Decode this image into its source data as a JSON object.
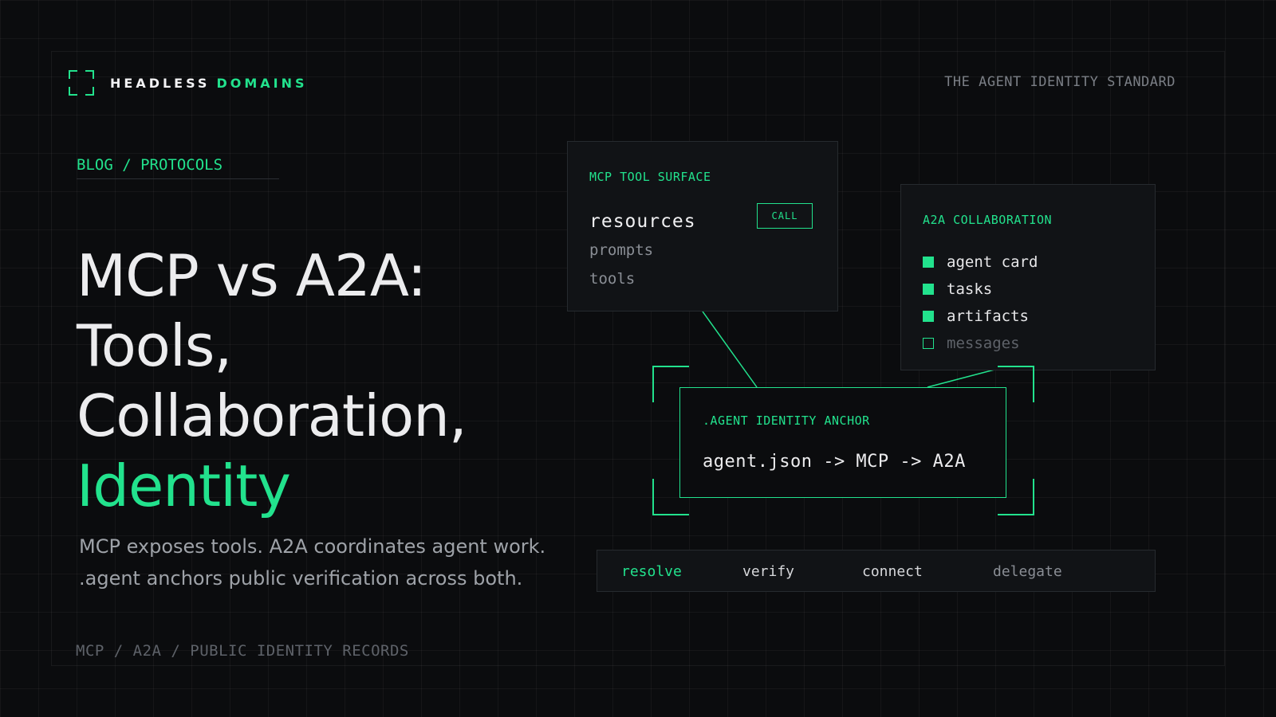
{
  "brand": {
    "name_white": "HEADLESS",
    "name_green": "DOMAINS",
    "icon": "bracket-frame-icon"
  },
  "header": {
    "tagline": "THE AGENT IDENTITY STANDARD"
  },
  "breadcrumb": "BLOG / PROTOCOLS",
  "headline": {
    "line1": "MCP vs A2A:",
    "line2": "Tools,",
    "line3": "Collaboration,",
    "line4": "Identity"
  },
  "subtitle": {
    "line1": "MCP exposes tools. A2A coordinates agent work.",
    "line2": ".agent anchors public verification across both."
  },
  "footer": {
    "crumb": "MCP / A2A / PUBLIC IDENTITY RECORDS"
  },
  "mcp_panel": {
    "title": "MCP TOOL SURFACE",
    "button": "CALL",
    "items": [
      "resources",
      "prompts",
      "tools"
    ]
  },
  "a2a_panel": {
    "title": "A2A COLLABORATION",
    "items": [
      {
        "label": "agent card",
        "checked": true
      },
      {
        "label": "tasks",
        "checked": true
      },
      {
        "label": "artifacts",
        "checked": true
      },
      {
        "label": "messages",
        "checked": false
      }
    ]
  },
  "anchor": {
    "title": ".AGENT IDENTITY ANCHOR",
    "flow": "agent.json -> MCP -> A2A"
  },
  "actions": [
    "resolve",
    "verify",
    "connect",
    "delegate"
  ],
  "colors": {
    "accent": "#22e28d",
    "background": "#0b0c0e",
    "panel": "#111316"
  }
}
